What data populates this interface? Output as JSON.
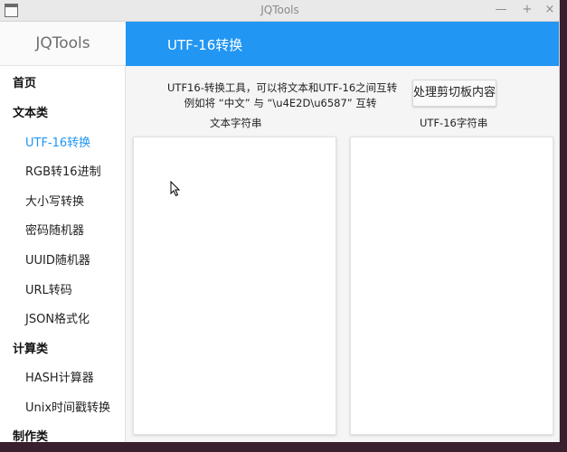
{
  "window": {
    "title": "JQTools",
    "minimize_symbol": "—",
    "maximize_symbol": "+",
    "close_symbol": "×"
  },
  "brand": "JQTools",
  "header": {
    "title": "UTF-16转换",
    "accent_color": "#2196f3"
  },
  "sidebar": {
    "items": [
      {
        "label": "首页",
        "kind": "category"
      },
      {
        "label": "文本类",
        "kind": "category"
      },
      {
        "label": "UTF-16转换",
        "kind": "item",
        "active": true
      },
      {
        "label": "RGB转16进制",
        "kind": "item"
      },
      {
        "label": "大小写转换",
        "kind": "item"
      },
      {
        "label": "密码随机器",
        "kind": "item"
      },
      {
        "label": "UUID随机器",
        "kind": "item"
      },
      {
        "label": "URL转码",
        "kind": "item"
      },
      {
        "label": "JSON格式化",
        "kind": "item"
      },
      {
        "label": "计算类",
        "kind": "category"
      },
      {
        "label": "HASH计算器",
        "kind": "item"
      },
      {
        "label": "Unix时间戳转换",
        "kind": "item"
      },
      {
        "label": "制作类",
        "kind": "category"
      }
    ]
  },
  "main": {
    "description_line1": "UTF16-转换工具，可以将文本和UTF-16之间互转",
    "description_line2": "例如将 “中文” 与 “\\u4E2D\\u6587” 互转",
    "clipboard_button": "处理剪切板内容",
    "text_column_label": "文本字符串",
    "utf16_column_label": "UTF-16字符串",
    "text_input_value": "",
    "utf16_input_value": ""
  }
}
